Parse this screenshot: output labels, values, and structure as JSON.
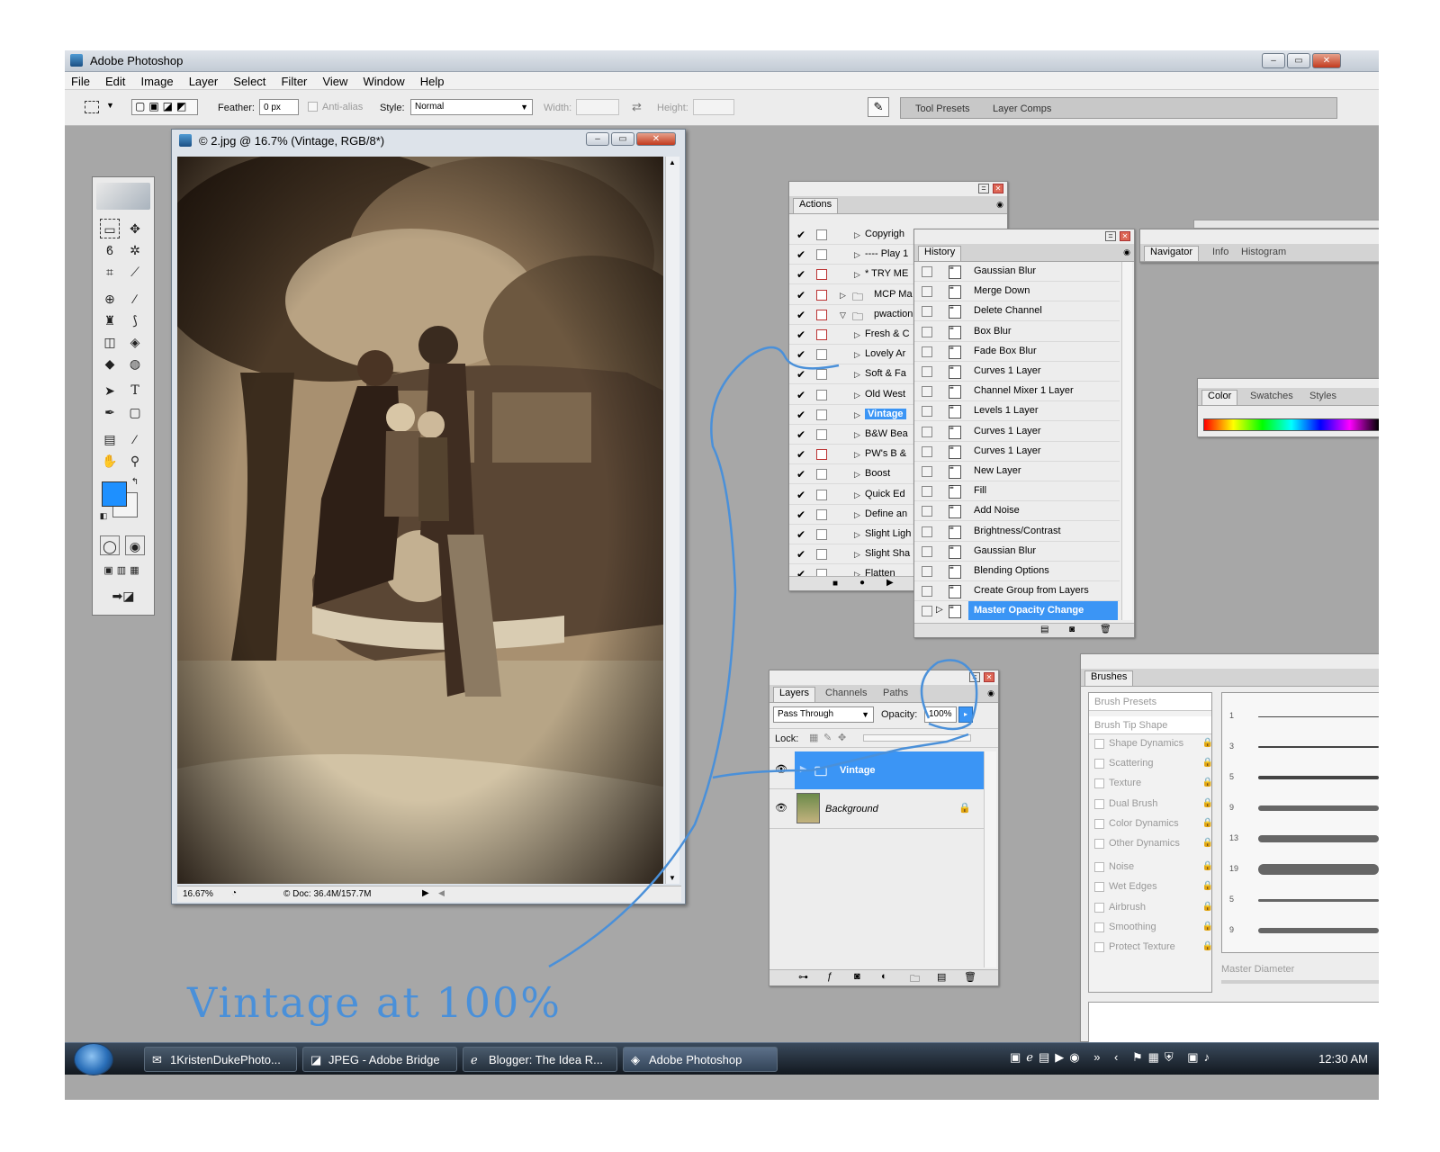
{
  "app": {
    "title": "Adobe Photoshop",
    "menu": [
      "File",
      "Edit",
      "Image",
      "Layer",
      "Select",
      "Filter",
      "View",
      "Window",
      "Help"
    ]
  },
  "options": {
    "feather_label": "Feather:",
    "feather_value": "0 px",
    "antialias_label": "Anti-alias",
    "style_label": "Style:",
    "style_value": "Normal",
    "width_label": "Width:",
    "height_label": "Height:",
    "tabs": [
      "Tool Presets",
      "Layer Comps"
    ]
  },
  "document": {
    "title": "© 2.jpg @ 16.7% (Vintage, RGB/8*)",
    "zoom": "16.67%",
    "doc_size": "© Doc: 36.4M/157.7M"
  },
  "actions": {
    "tab": "Actions",
    "items": [
      {
        "label": "Copyrigh",
        "red": false,
        "folder": false
      },
      {
        "label": "---- Play 1",
        "red": false,
        "folder": false
      },
      {
        "label": "* TRY ME",
        "red": true,
        "folder": false
      },
      {
        "label": "MCP Ma",
        "red": true,
        "folder": true
      },
      {
        "label": "pwaction",
        "red": true,
        "folder": true
      },
      {
        "label": "Fresh & C",
        "red": true,
        "folder": false
      },
      {
        "label": "Lovely Ar",
        "red": false,
        "folder": false
      },
      {
        "label": "Soft & Fa",
        "red": false,
        "folder": false
      },
      {
        "label": "Old West",
        "red": false,
        "folder": false
      },
      {
        "label": "Vintage",
        "red": false,
        "folder": false,
        "selected": true
      },
      {
        "label": "B&W Bea",
        "red": false,
        "folder": false
      },
      {
        "label": "PW's B &",
        "red": true,
        "folder": false
      },
      {
        "label": "Boost",
        "red": false,
        "folder": false
      },
      {
        "label": "Quick Ed",
        "red": false,
        "folder": false
      },
      {
        "label": "Define an",
        "red": false,
        "folder": false
      },
      {
        "label": "Slight Ligh",
        "red": false,
        "folder": false
      },
      {
        "label": "Slight Sha",
        "red": false,
        "folder": false
      },
      {
        "label": "Flatten",
        "red": false,
        "folder": false
      }
    ]
  },
  "history": {
    "tab": "History",
    "items": [
      "Gaussian Blur",
      "Merge Down",
      "Delete Channel",
      "Box Blur",
      "Fade Box Blur",
      "Curves 1 Layer",
      "Channel Mixer 1 Layer",
      "Levels 1 Layer",
      "Curves 1 Layer",
      "Curves 1 Layer",
      "New Layer",
      "Fill",
      "Add Noise",
      "Brightness/Contrast",
      "Gaussian Blur",
      "Blending Options",
      "Create Group from Layers",
      "Master Opacity Change"
    ],
    "selected_index": 17
  },
  "navigator": {
    "tabs": [
      "Navigator",
      "Info",
      "Histogram"
    ]
  },
  "color": {
    "tabs": [
      "Color",
      "Swatches",
      "Styles"
    ]
  },
  "layers": {
    "tabs": [
      "Layers",
      "Channels",
      "Paths"
    ],
    "blend_mode": "Pass Through",
    "opacity_label": "Opacity:",
    "opacity_value": "100%",
    "lock_label": "Lock:",
    "items": [
      {
        "name": "Vintage",
        "selected": true
      },
      {
        "name": "Background",
        "selected": false
      }
    ]
  },
  "brushes": {
    "tab": "Brushes",
    "items": [
      "Brush Presets",
      "Brush Tip Shape",
      "Shape Dynamics",
      "Scattering",
      "Texture",
      "Dual Brush",
      "Color Dynamics",
      "Other Dynamics",
      "Noise",
      "Wet Edges",
      "Airbrush",
      "Smoothing",
      "Protect Texture"
    ],
    "sizes": [
      "1",
      "3",
      "5",
      "9",
      "13",
      "19",
      "5",
      "9"
    ],
    "master_diameter_label": "Master Diameter"
  },
  "taskbar": {
    "items": [
      "1KristenDukePhoto...",
      "JPEG - Adobe Bridge",
      "Blogger: The Idea R...",
      "Adobe Photoshop"
    ],
    "clock": "12:30 AM"
  },
  "annotation": {
    "text": "Vintage at 100%",
    "color": "#4a90d9"
  },
  "colors": {
    "foreground": "#1e90ff",
    "selection": "#3b95f5"
  }
}
